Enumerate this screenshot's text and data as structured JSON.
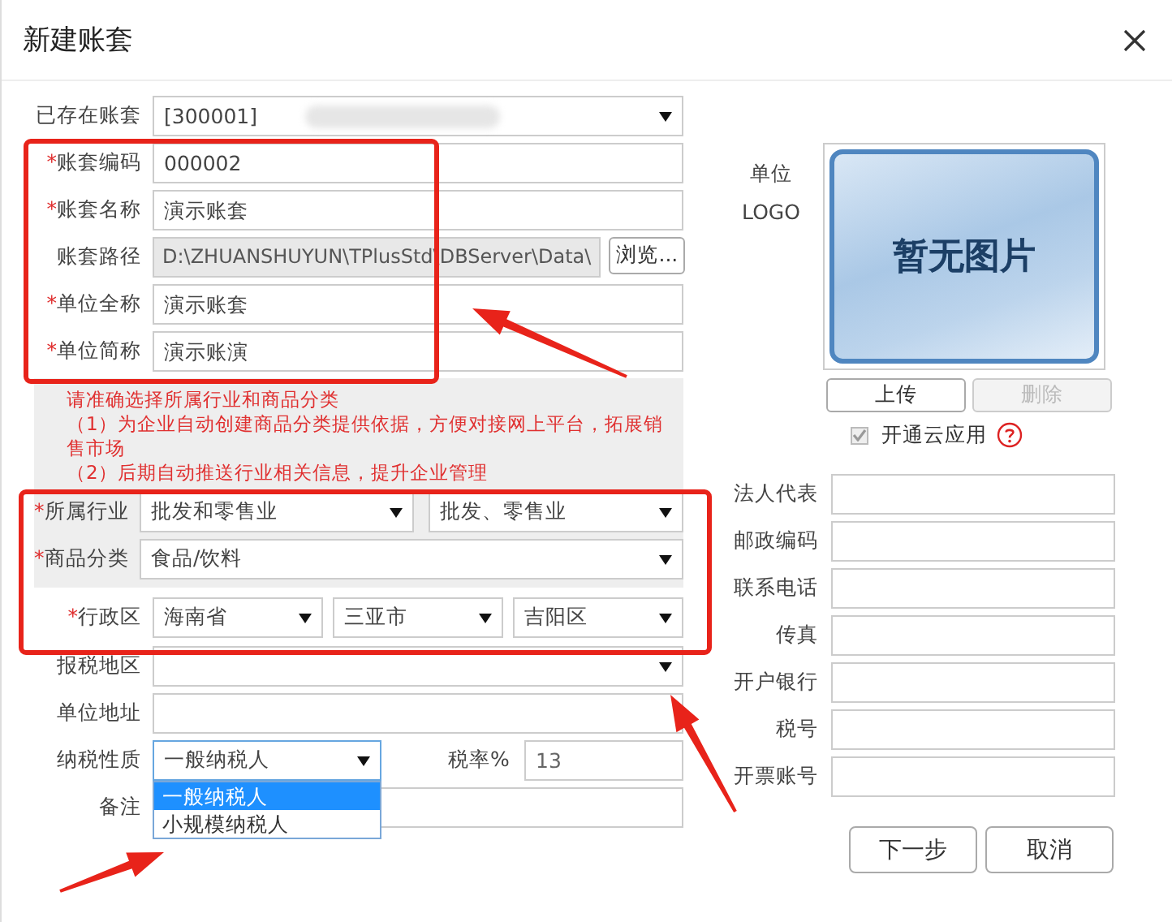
{
  "dialog": {
    "title": "新建账套"
  },
  "left_rows": [
    {
      "kind": "select",
      "label": "已存在账套",
      "value": "[300001]",
      "redacted": true
    },
    {
      "kind": "input",
      "label": "账套编码",
      "required_mark": "*",
      "value": "000002"
    },
    {
      "kind": "input",
      "label": "账套名称",
      "required_mark": "*",
      "value": "演示账套"
    },
    {
      "kind": "path",
      "label": "账套路径",
      "value": "D:\\ZHUANSHUYUN\\TPlusStd\\DBServer\\Data\\",
      "disabled": true,
      "button": "浏览..."
    },
    {
      "kind": "input",
      "label": "单位全称",
      "required_mark": "*",
      "value": "演示账套"
    },
    {
      "kind": "input",
      "label": "单位简称",
      "required_mark": "*",
      "value": "演示账演"
    }
  ],
  "hint": {
    "lines": [
      "请准确选择所属行业和商品分类",
      "（1）为企业自动创建商品分类提供依据，方便对接网上平台，拓展销售市场",
      "（2）后期自动推送行业相关信息，提升企业管理"
    ]
  },
  "classification_rows": [
    {
      "label": "所属行业",
      "required_mark": "*",
      "selects": [
        "批发和零售业",
        "批发、零售业"
      ]
    },
    {
      "label": "商品分类",
      "required_mark": "*",
      "selects": [
        "食品/饮料"
      ]
    }
  ],
  "region_row": {
    "label": "行政区",
    "required_mark": "*",
    "selects": [
      "海南省",
      "三亚市",
      "吉阳区"
    ]
  },
  "lower_rows": [
    {
      "kind": "select",
      "label": "报税地区"
    },
    {
      "kind": "input",
      "label": "单位地址"
    },
    {
      "kind": "tax",
      "label": "纳税性质",
      "value": "一般纳税人",
      "expanded": true,
      "options": [
        {
          "label": "一般纳税人",
          "selected": true
        },
        {
          "label": "小规模纳税人",
          "selected": false
        }
      ],
      "rate_label": "税率%",
      "rate_value": "13"
    },
    {
      "kind": "input",
      "label": "备注"
    }
  ],
  "logo": {
    "label_lines": [
      "单位",
      "LOGO"
    ],
    "placeholder_text": "暂无图片",
    "upload_button": {
      "label": "上传",
      "disabled": false
    },
    "delete_button": {
      "label": "删除",
      "disabled": true
    }
  },
  "cloud_option": {
    "label": "开通云应用",
    "checked": true,
    "disabled": true
  },
  "right_fields": [
    {
      "label": "法人代表"
    },
    {
      "label": "邮政编码"
    },
    {
      "label": "联系电话"
    },
    {
      "label": "传真"
    },
    {
      "label": "开户银行"
    },
    {
      "label": "税号"
    },
    {
      "label": "开票账号"
    }
  ],
  "buttons": [
    {
      "label": "下一步"
    },
    {
      "label": "取消"
    }
  ]
}
